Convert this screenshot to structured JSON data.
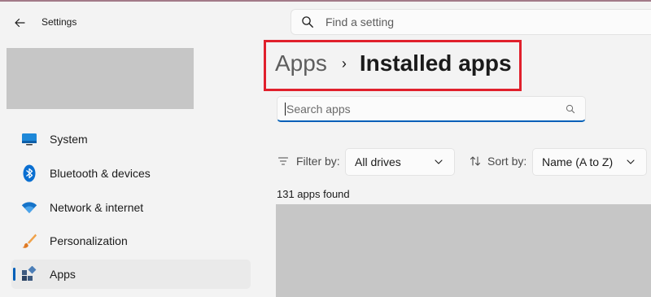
{
  "window": {
    "title": "Settings"
  },
  "search": {
    "placeholder": "Find a setting"
  },
  "sidebar": {
    "items": [
      {
        "label": "System",
        "icon": "system-icon",
        "active": false
      },
      {
        "label": "Bluetooth & devices",
        "icon": "bluetooth-icon",
        "active": false
      },
      {
        "label": "Network & internet",
        "icon": "wifi-icon",
        "active": false
      },
      {
        "label": "Personalization",
        "icon": "brush-icon",
        "active": false
      },
      {
        "label": "Apps",
        "icon": "apps-icon",
        "active": true
      }
    ]
  },
  "breadcrumb": {
    "parent": "Apps",
    "separator": "›",
    "current": "Installed apps"
  },
  "apps_search": {
    "placeholder": "Search apps"
  },
  "filter": {
    "label": "Filter by:",
    "value": "All drives"
  },
  "sort": {
    "label": "Sort by:",
    "value": "Name (A to Z)"
  },
  "results": {
    "count_text": "131 apps found"
  },
  "colors": {
    "accent": "#005fb8",
    "highlight": "#e0202c"
  }
}
